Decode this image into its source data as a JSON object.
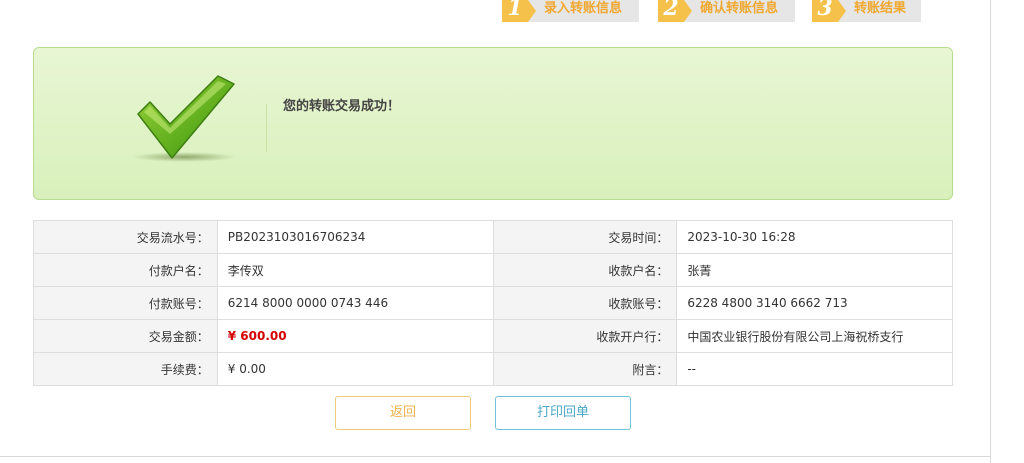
{
  "steps": [
    {
      "num": "1",
      "label": "录入转账信息"
    },
    {
      "num": "2",
      "label": "确认转账信息"
    },
    {
      "num": "3",
      "label": "转账结果"
    }
  ],
  "success": {
    "message": "您的转账交易成功！"
  },
  "details": {
    "rows": [
      {
        "k1": "交易流水号：",
        "v1": "PB2023103016706234",
        "k2": "交易时间：",
        "v2": "2023-10-30 16:28"
      },
      {
        "k1": "付款户名：",
        "v1": "李传双",
        "k2": "收款户名：",
        "v2": "张菁"
      },
      {
        "k1": "付款账号：",
        "v1": "6214 8000 0000 0743 446",
        "k2": "收款账号：",
        "v2": "6228 4800 3140 6662 713"
      },
      {
        "k1": "交易金额：",
        "v1": "¥ 600.00",
        "k2": "收款开户行：",
        "v2": "中国农业银行股份有限公司上海祝桥支行"
      },
      {
        "k1": "手续费：",
        "v1": "¥ 0.00",
        "k2": "附言：",
        "v2": "--"
      }
    ]
  },
  "buttons": {
    "back": "返回",
    "print": "打印回单"
  },
  "colors": {
    "amount": "#d40000",
    "step_accent": "#f5c14a",
    "success_border": "#b8dc90"
  }
}
